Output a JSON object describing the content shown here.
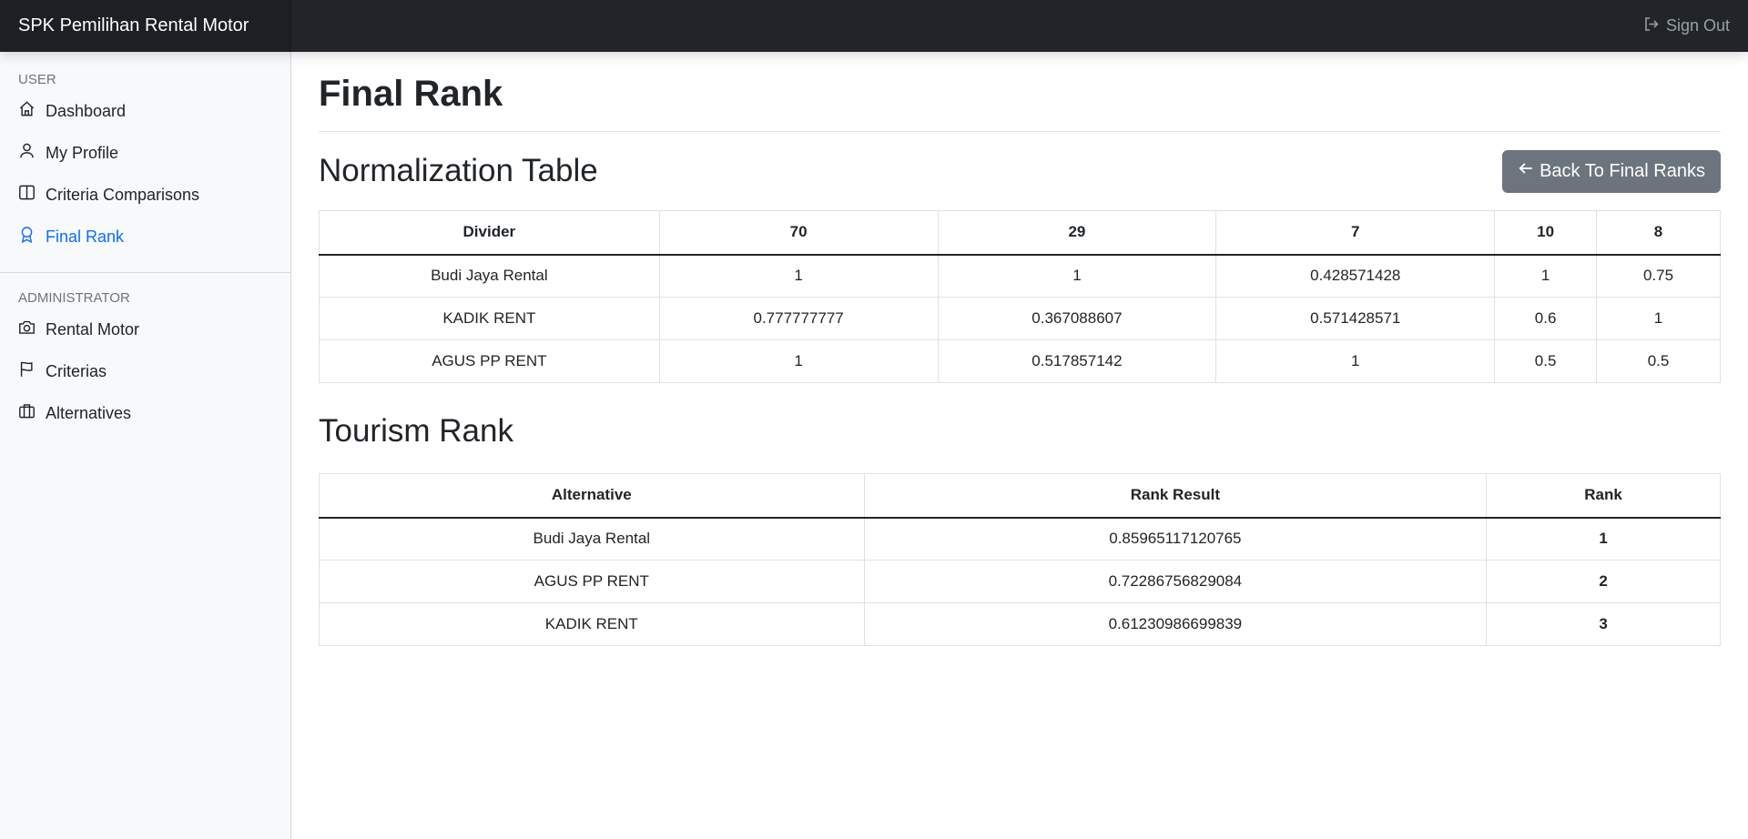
{
  "app": {
    "brand": "SPK Pemilihan Rental Motor",
    "signout_label": "Sign Out"
  },
  "sidebar": {
    "user_heading": "USER",
    "user_items": [
      {
        "label": "Dashboard",
        "icon": "house-icon"
      },
      {
        "label": "My Profile",
        "icon": "person-icon"
      },
      {
        "label": "Criteria Comparisons",
        "icon": "columns-icon"
      },
      {
        "label": "Final Rank",
        "icon": "award-icon",
        "active": true
      }
    ],
    "admin_heading": "ADMINISTRATOR",
    "admin_items": [
      {
        "label": "Rental Motor",
        "icon": "camera-icon"
      },
      {
        "label": "Criterias",
        "icon": "flag-icon"
      },
      {
        "label": "Alternatives",
        "icon": "briefcase-icon"
      }
    ]
  },
  "main": {
    "page_title": "Final Rank",
    "normalization_title": "Normalization Table",
    "back_button": "Back To Final Ranks",
    "normalization": {
      "headers": [
        "Divider",
        "70",
        "29",
        "7",
        "10",
        "8"
      ],
      "rows": [
        [
          "Budi Jaya Rental",
          "1",
          "1",
          "0.428571428",
          "1",
          "0.75"
        ],
        [
          "KADIK RENT",
          "0.777777777",
          "0.367088607",
          "0.571428571",
          "0.6",
          "1"
        ],
        [
          "AGUS PP RENT",
          "1",
          "0.517857142",
          "1",
          "0.5",
          "0.5"
        ]
      ]
    },
    "tourism_title": "Tourism Rank",
    "tourism": {
      "headers": [
        "Alternative",
        "Rank Result",
        "Rank"
      ],
      "rows": [
        [
          "Budi Jaya Rental",
          "0.85965117120765",
          "1"
        ],
        [
          "AGUS PP RENT",
          "0.72286756829084",
          "2"
        ],
        [
          "KADIK RENT",
          "0.61230986699839",
          "3"
        ]
      ]
    }
  },
  "colors": {
    "topbar": "#212529",
    "active_link": "#0d6efd",
    "secondary_button": "#6c757d"
  }
}
